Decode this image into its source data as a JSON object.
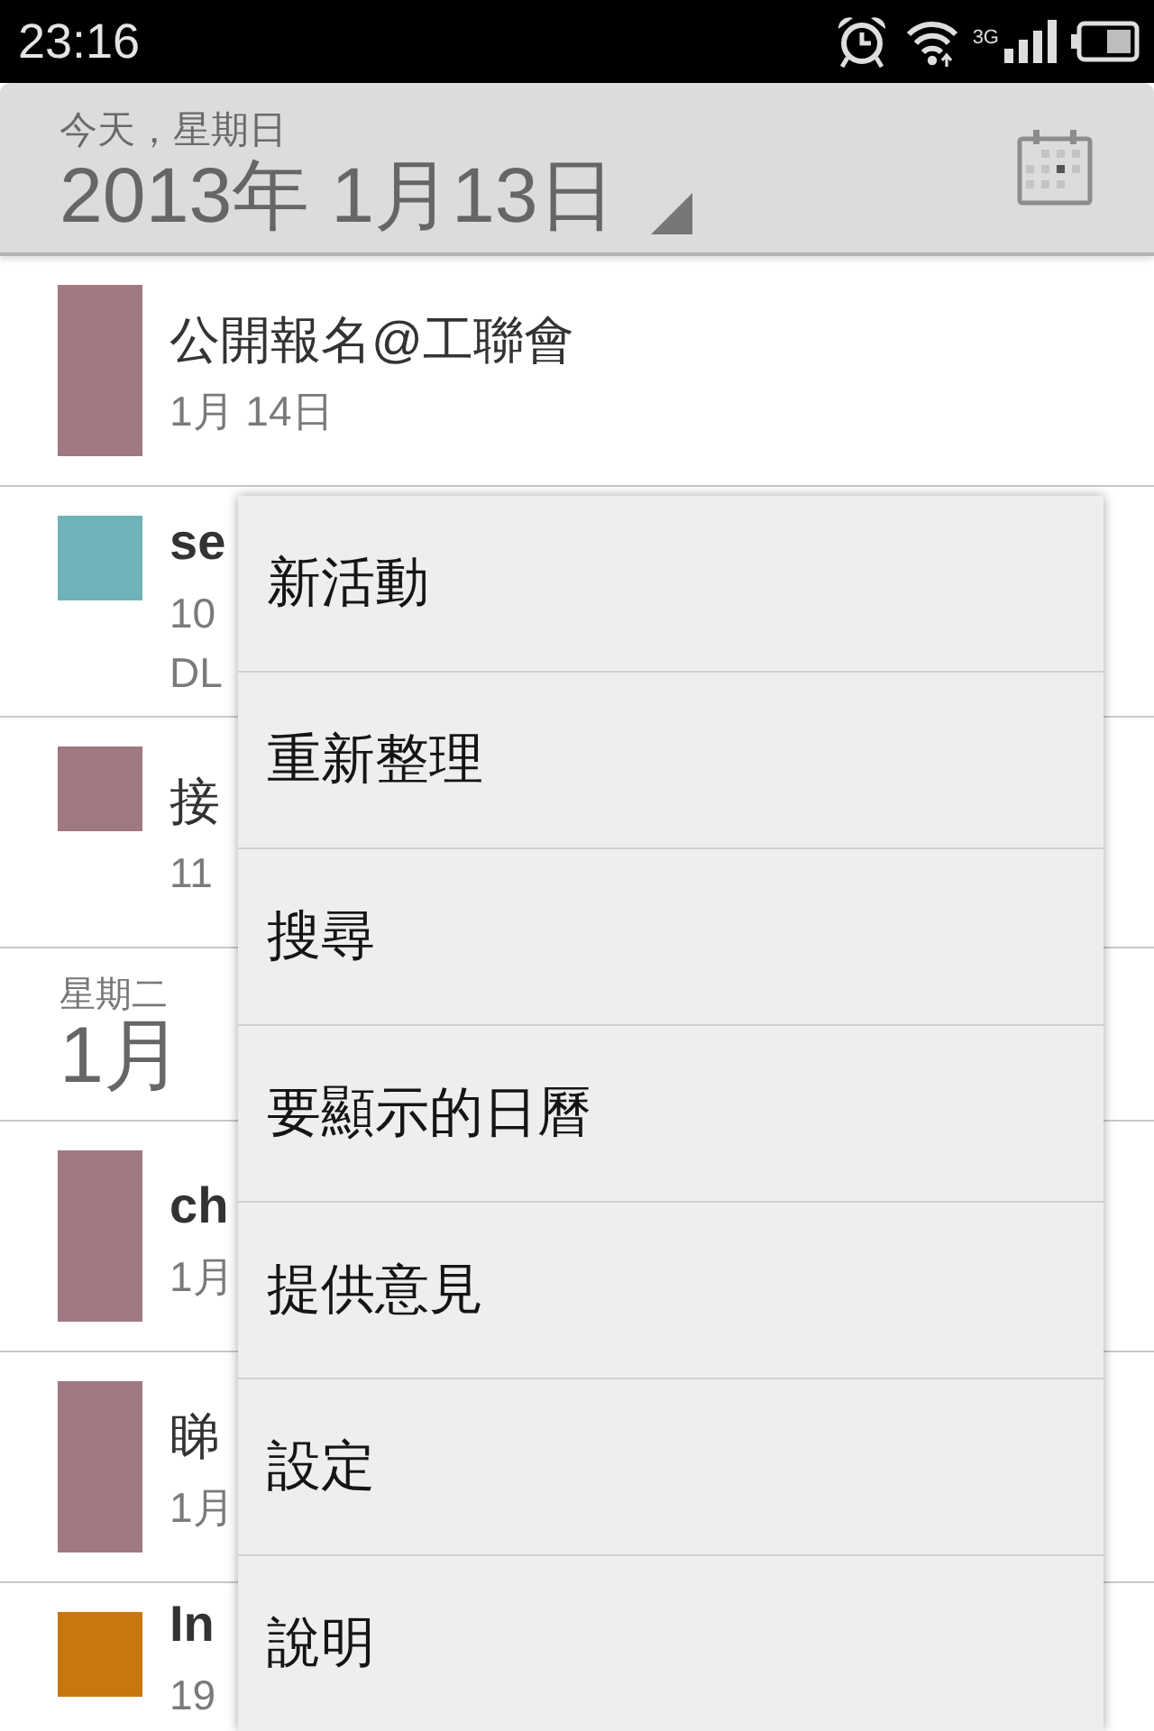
{
  "status_bar": {
    "time": "23:16",
    "network": "3G"
  },
  "header": {
    "day_label": "今天，星期日",
    "date": "2013年 1月13日"
  },
  "agenda": [
    {
      "kind": "event",
      "tall_chip": true,
      "color": "#a07880",
      "title": "公開報名@工聯會",
      "bold": false,
      "details": [
        "1月 14日"
      ]
    },
    {
      "kind": "event",
      "tall_chip": false,
      "color": "#6fb3b8",
      "title": "se",
      "bold": true,
      "details": [
        "10",
        "DL"
      ]
    },
    {
      "kind": "event",
      "tall_chip": false,
      "color": "#a07880",
      "title": "接",
      "bold": false,
      "details": [
        "11"
      ]
    },
    {
      "kind": "day",
      "weekday": "星期二",
      "date": "1月"
    },
    {
      "kind": "event",
      "tall_chip": true,
      "color": "#a07880",
      "title": "ch",
      "bold": true,
      "details": [
        "1月"
      ]
    },
    {
      "kind": "event",
      "tall_chip": true,
      "color": "#a07880",
      "title": "睇",
      "bold": false,
      "details": [
        "1月"
      ]
    },
    {
      "kind": "event",
      "tall_chip": false,
      "color": "#c8760e",
      "title": "In",
      "bold": true,
      "details": [
        "19"
      ]
    }
  ],
  "menu": {
    "items": [
      "新活動",
      "重新整理",
      "搜尋",
      "要顯示的日曆",
      "提供意見",
      "設定",
      "說明"
    ]
  }
}
